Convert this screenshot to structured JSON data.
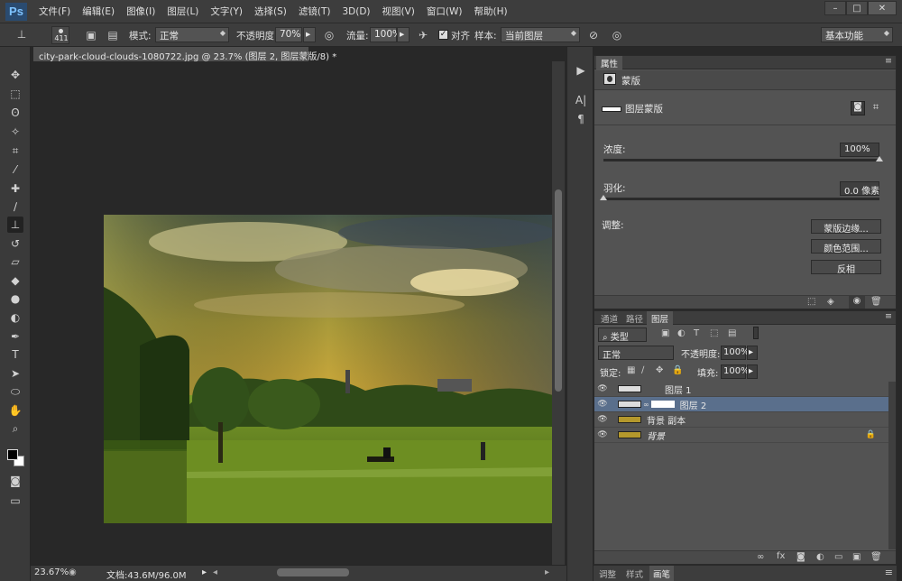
{
  "app": {
    "logo": "Ps"
  },
  "menu": [
    "文件(F)",
    "编辑(E)",
    "图像(I)",
    "图层(L)",
    "文字(Y)",
    "选择(S)",
    "滤镜(T)",
    "3D(D)",
    "视图(V)",
    "窗口(W)",
    "帮助(H)"
  ],
  "window_controls": {
    "minimize": "–",
    "maximize": "□",
    "close": "✕"
  },
  "options": {
    "brush_size": "411",
    "mode_label": "模式:",
    "mode_value": "正常",
    "opacity_label": "不透明度:",
    "opacity_value": "70%",
    "flow_label": "流量:",
    "flow_value": "100%",
    "align_label": "对齐",
    "sample_label": "样本:",
    "sample_value": "当前图层",
    "workspace": "基本功能"
  },
  "document": {
    "tab_title": "city-park-cloud-clouds-1080722.jpg @ 23.7% (图层 2, 图层蒙版/8) *",
    "zoom": "23.67%",
    "doc_size": "文档:43.6M/96.0M"
  },
  "properties": {
    "tab": "属性",
    "header": "蒙版",
    "mask_type": "图层蒙版",
    "density_label": "浓度:",
    "density_value": "100%",
    "density_level": 1.0,
    "feather_label": "羽化:",
    "feather_value": "0.0 像素",
    "feather_level": 0.0,
    "adjust_label": "调整:",
    "buttons": [
      "蒙版边缘...",
      "颜色范围...",
      "反相"
    ]
  },
  "layers_panel": {
    "tabs": [
      "通道",
      "路径",
      "图层"
    ],
    "active_tab": "图层",
    "filter_kind": "类型",
    "blend_mode": "正常",
    "opacity_label": "不透明度:",
    "opacity_value": "100%",
    "lock_label": "锁定:",
    "fill_label": "填充:",
    "fill_value": "100%",
    "layers": [
      {
        "name": "图层 1",
        "selected": false
      },
      {
        "name": "图层 2",
        "selected": true
      },
      {
        "name": "背景 副本",
        "selected": false
      },
      {
        "name": "背景",
        "selected": false
      }
    ]
  },
  "bottom_tabs": [
    "调整",
    "样式",
    "画笔"
  ],
  "colors": {
    "accent_selected": "#5a6f8c",
    "panel_bg": "#535353",
    "app_bg": "#282828"
  }
}
